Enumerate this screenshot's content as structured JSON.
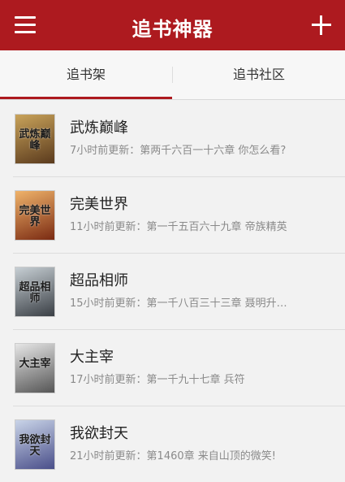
{
  "header": {
    "title": "追书神器"
  },
  "tabs": [
    {
      "label": "追书架",
      "active": true
    },
    {
      "label": "追书社区",
      "active": false
    }
  ],
  "books": [
    {
      "title": "武炼巅峰",
      "update": "7小时前更新：第两千六百一十六章 你怎么看?",
      "cover_colors": [
        "#c9a35a",
        "#5a3a1d"
      ],
      "cover_text": "武炼巅峰"
    },
    {
      "title": "完美世界",
      "update": "11小时前更新：第一千五百六十九章 帝族精英",
      "cover_colors": [
        "#f0b36a",
        "#7a2a12"
      ],
      "cover_text": "完美世界"
    },
    {
      "title": "超品相师",
      "update": "15小时前更新：第一千八百三十三章 聂明升…",
      "cover_colors": [
        "#c7cfd4",
        "#3a3f45"
      ],
      "cover_text": "超品相师"
    },
    {
      "title": "大主宰",
      "update": "17小时前更新：第一千九十七章 兵符",
      "cover_colors": [
        "#e6e6e6",
        "#555555"
      ],
      "cover_text": "大主宰"
    },
    {
      "title": "我欲封天",
      "update": "21小时前更新：第1460章 来自山顶的微笑!",
      "cover_colors": [
        "#c9d4e8",
        "#4a4f8a"
      ],
      "cover_text": "我欲封天"
    }
  ]
}
